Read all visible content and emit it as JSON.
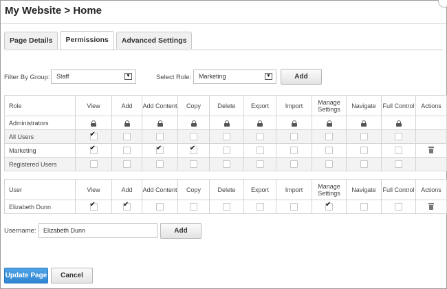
{
  "header": {
    "title": "My Website > Home"
  },
  "tabs": [
    {
      "label": "Page Details",
      "active": false
    },
    {
      "label": "Permissions",
      "active": true
    },
    {
      "label": "Advanced Settings",
      "active": false
    }
  ],
  "filter": {
    "label": "Filter By Group:",
    "value": "Staff"
  },
  "role_select": {
    "label": "Select Role:",
    "value": "Marketing",
    "add_label": "Add"
  },
  "columns": [
    "View",
    "Add",
    "Add Content",
    "Copy",
    "Delete",
    "Export",
    "Import",
    "Manage Settings",
    "Navigate",
    "Full Control",
    "Actions"
  ],
  "role_table": {
    "header": "Role",
    "rows": [
      {
        "name": "Administrators",
        "cells": [
          "lock",
          "lock",
          "lock",
          "lock",
          "lock",
          "lock",
          "lock",
          "lock",
          "lock",
          "lock"
        ],
        "delete": false
      },
      {
        "name": "All Users",
        "cells": [
          "on",
          "off",
          "off",
          "off",
          "off",
          "off",
          "off",
          "off",
          "off",
          "off"
        ],
        "delete": false
      },
      {
        "name": "Marketing",
        "cells": [
          "on",
          "off",
          "on",
          "on",
          "off",
          "off",
          "off",
          "off",
          "off",
          "off"
        ],
        "delete": true
      },
      {
        "name": "Registered Users",
        "cells": [
          "off",
          "off",
          "off",
          "off",
          "off",
          "off",
          "off",
          "off",
          "off",
          "off"
        ],
        "delete": false
      }
    ]
  },
  "user_table": {
    "header": "User",
    "rows": [
      {
        "name": "Elizabeth Dunn",
        "cells": [
          "on",
          "on",
          "off",
          "off",
          "off",
          "off",
          "off",
          "on",
          "off",
          "off"
        ],
        "delete": true
      }
    ]
  },
  "username": {
    "label": "Username:",
    "value": "Elizabeth Dunn",
    "add_label": "Add"
  },
  "footer": {
    "update_label": "Update Page",
    "cancel_label": "Cancel"
  }
}
